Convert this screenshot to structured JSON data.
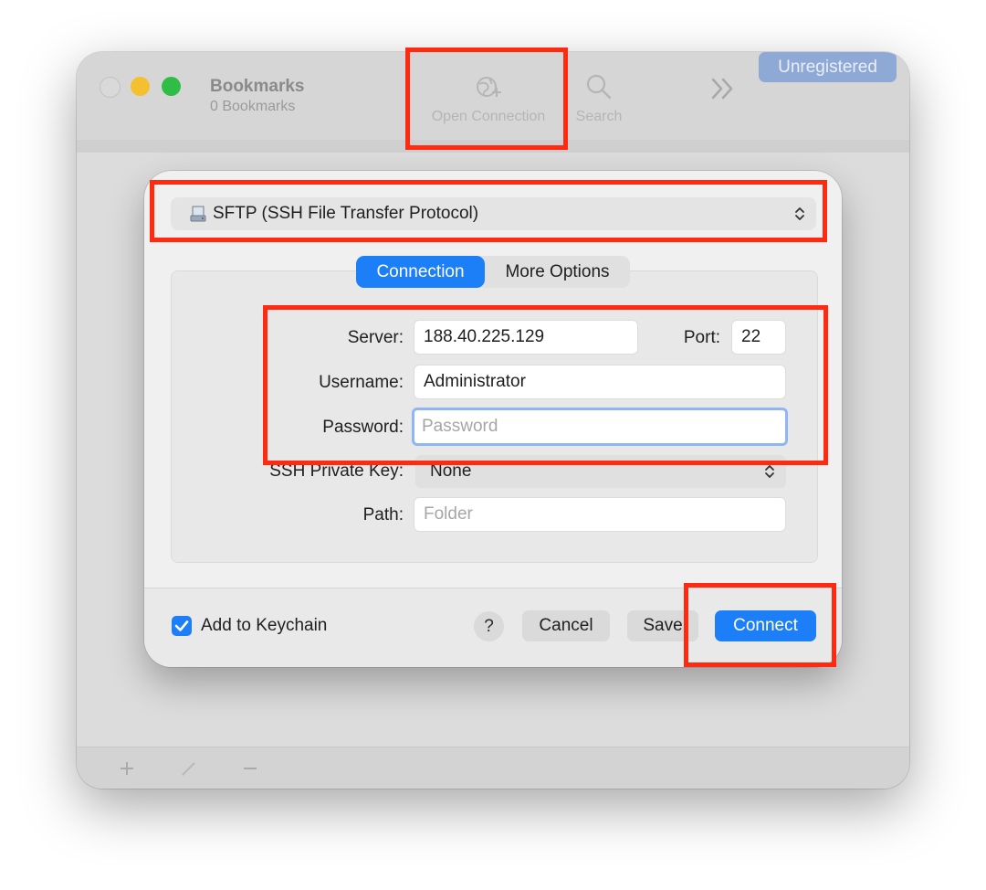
{
  "window": {
    "title": "Bookmarks",
    "subtitle": "0 Bookmarks",
    "unregistered_label": "Unregistered",
    "toolbar": {
      "open_connection_label": "Open Connection",
      "search_label": "Search"
    }
  },
  "dialog": {
    "protocol": "SFTP (SSH File Transfer Protocol)",
    "tabs": [
      {
        "label": "Connection",
        "active": true
      },
      {
        "label": "More Options",
        "active": false
      }
    ],
    "fields": {
      "server_label": "Server:",
      "server_value": "188.40.225.129",
      "port_label": "Port:",
      "port_value": "22",
      "username_label": "Username:",
      "username_value": "Administrator",
      "password_label": "Password:",
      "password_placeholder": "Password",
      "ssh_key_label": "SSH Private Key:",
      "ssh_key_value": "None",
      "path_label": "Path:",
      "path_placeholder": "Folder"
    },
    "footer": {
      "keychain_label": "Add to Keychain",
      "keychain_checked": true,
      "help_label": "?",
      "cancel_label": "Cancel",
      "save_label": "Save",
      "connect_label": "Connect"
    }
  },
  "colors": {
    "accent": "#1d7ff8",
    "highlight": "#ff2a10",
    "unregistered_badge": "#8fa9d6"
  }
}
